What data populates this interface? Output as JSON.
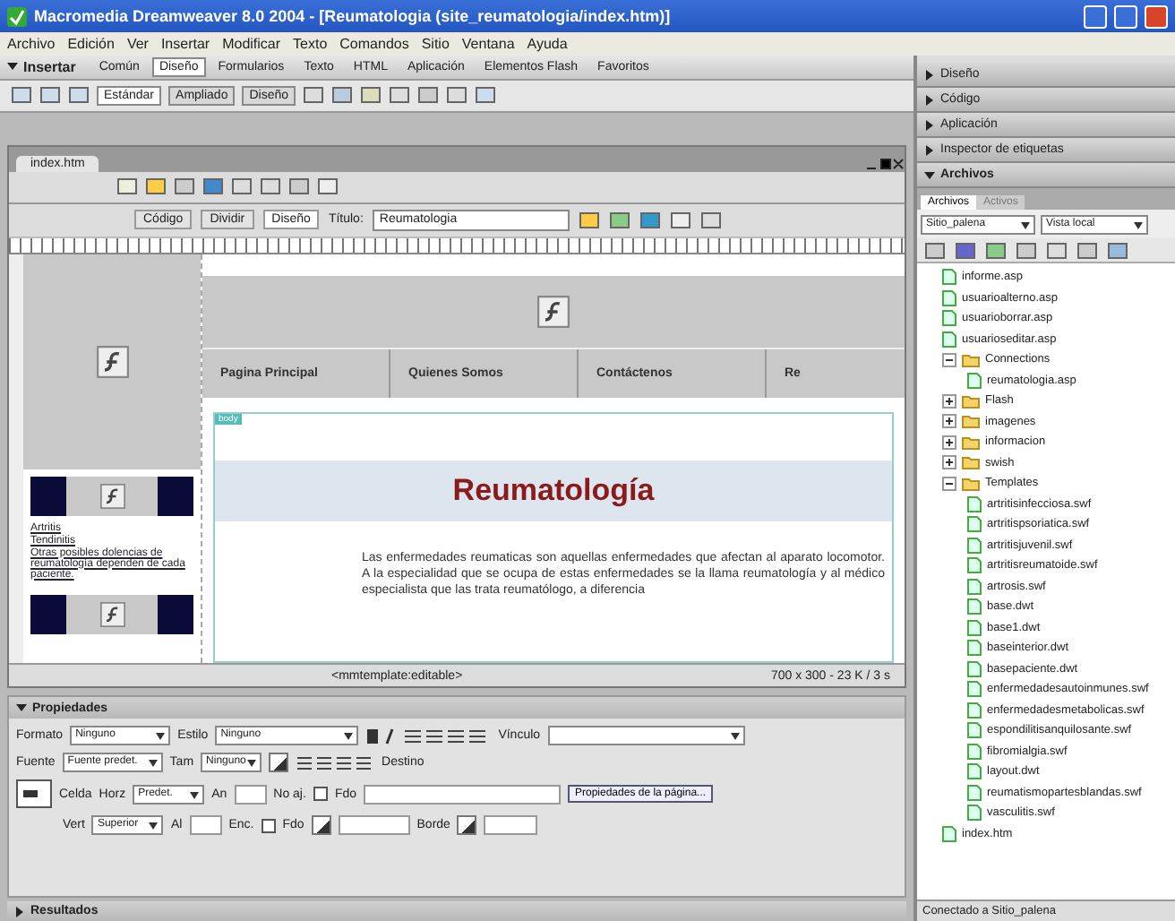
{
  "window": {
    "title": "Macromedia Dreamweaver 8.0 2004 - [Reumatologia (site_reumatologia/index.htm)]"
  },
  "menu": [
    "Archivo",
    "Edición",
    "Ver",
    "Insertar",
    "Modificar",
    "Texto",
    "Comandos",
    "Sitio",
    "Ventana",
    "Ayuda"
  ],
  "insert_bar": {
    "title": "Insertar",
    "tabs": [
      {
        "label": "Común",
        "selected": false
      },
      {
        "label": "Diseño",
        "selected": true
      },
      {
        "label": "Formularios",
        "selected": false
      },
      {
        "label": "Texto",
        "selected": false
      },
      {
        "label": "HTML",
        "selected": false
      },
      {
        "label": "Aplicación",
        "selected": false
      },
      {
        "label": "Elementos Flash",
        "selected": false
      },
      {
        "label": "Favoritos",
        "selected": false
      }
    ],
    "layout_modes": [
      {
        "label": "Estándar",
        "selected": true
      },
      {
        "label": "Ampliado",
        "selected": false
      },
      {
        "label": "Diseño",
        "selected": false
      }
    ]
  },
  "document": {
    "tab": "index.htm",
    "views": [
      {
        "label": "Código",
        "selected": false
      },
      {
        "label": "Dividir",
        "selected": false
      },
      {
        "label": "Diseño",
        "selected": true
      }
    ],
    "title_label": "Título:",
    "title_value": "Reumatologia"
  },
  "page": {
    "nav": [
      "Pagina Principal",
      "Quienes Somos",
      "Contáctenos",
      "Re"
    ],
    "region_label": "body",
    "sidebar_links": [
      "Artritis",
      "Tendinitis",
      "Otras posibles dolencias de reumatología dependen de cada paciente."
    ],
    "heading": "Reumatología",
    "paragraph": "Las enfermedades reumaticas son aquellas enfermedades que afectan al aparato locomotor. A la especialidad que se ocupa de estas enfermedades se la llama reumatología y al médico especialista que las trata reumatólogo, a diferencia"
  },
  "status": {
    "tag": "<mmtemplate:editable>",
    "info": "700 x 300 - 23 K / 3 s"
  },
  "properties": {
    "title": "Propiedades",
    "rows": [
      [
        {
          "kind": "label",
          "text": "Formato"
        },
        {
          "kind": "select",
          "text": "Ninguno"
        },
        {
          "kind": "label",
          "text": "Estilo"
        },
        {
          "kind": "select",
          "text": "Ninguno"
        },
        {
          "kind": "format"
        },
        {
          "kind": "label",
          "text": "Vínculo"
        },
        {
          "kind": "select"
        }
      ],
      [
        {
          "kind": "label",
          "text": "Fuente"
        },
        {
          "kind": "select",
          "text": "Fuente predet."
        },
        {
          "kind": "label",
          "text": "Tam"
        },
        {
          "kind": "select",
          "text": "Ninguno"
        },
        {
          "kind": "swatch"
        },
        {
          "kind": "lists"
        },
        {
          "kind": "label",
          "text": "Destino"
        }
      ],
      [
        {
          "kind": "label",
          "text": "Celda"
        },
        {
          "kind": "label",
          "text": "Horz"
        },
        {
          "kind": "select",
          "text": "Predet."
        },
        {
          "kind": "label",
          "text": "An"
        },
        {
          "kind": "input"
        },
        {
          "kind": "label",
          "text": "No aj."
        },
        {
          "kind": "check",
          "checked": false
        },
        {
          "kind": "label",
          "text": "Fdo"
        },
        {
          "kind": "input"
        },
        {
          "kind": "button",
          "text": "Propiedades de la página..."
        }
      ],
      [
        {
          "kind": "label",
          "text": "Vert"
        },
        {
          "kind": "select",
          "text": "Superior"
        },
        {
          "kind": "label",
          "text": "Al"
        },
        {
          "kind": "input"
        },
        {
          "kind": "label",
          "text": "Enc."
        },
        {
          "kind": "check",
          "checked": false
        },
        {
          "kind": "label",
          "text": "Fdo"
        },
        {
          "kind": "swatch"
        },
        {
          "kind": "input"
        },
        {
          "kind": "label",
          "text": "Borde"
        },
        {
          "kind": "swatch"
        },
        {
          "kind": "input"
        }
      ]
    ]
  },
  "results": {
    "title": "Resultados"
  },
  "panels": [
    {
      "label": "Diseño",
      "expanded": false
    },
    {
      "label": "Código",
      "expanded": false
    },
    {
      "label": "Aplicación",
      "expanded": false
    },
    {
      "label": "Inspector de etiquetas",
      "expanded": false
    },
    {
      "label": "Archivos",
      "expanded": true
    }
  ],
  "files": {
    "tabs": [
      {
        "label": "Archivos",
        "selected": true
      },
      {
        "label": "Activos",
        "selected": false
      }
    ],
    "site": "Sitio_palena",
    "view": "Vista local",
    "tree": [
      {
        "name": "informe.asp",
        "kind": "file"
      },
      {
        "name": "usuarioalterno.asp",
        "kind": "file"
      },
      {
        "name": "usuarioborrar.asp",
        "kind": "file"
      },
      {
        "name": "usuarioseditar.asp",
        "kind": "file"
      },
      {
        "name": "Connections",
        "kind": "folder",
        "expanded": true,
        "children": [
          {
            "name": "reumatologia.asp",
            "kind": "file"
          }
        ]
      },
      {
        "name": "Flash",
        "kind": "folder",
        "expanded": false
      },
      {
        "name": "imagenes",
        "kind": "folder",
        "expanded": false
      },
      {
        "name": "informacion",
        "kind": "folder",
        "expanded": false
      },
      {
        "name": "swish",
        "kind": "folder",
        "expanded": false
      },
      {
        "name": "Templates",
        "kind": "folder",
        "expanded": true,
        "children": [
          {
            "name": "artritisinfecciosa.swf",
            "kind": "file"
          },
          {
            "name": "artritispsoriatica.swf",
            "kind": "file"
          },
          {
            "name": "artritisjuvenil.swf",
            "kind": "file"
          },
          {
            "name": "artritisreumatoide.swf",
            "kind": "file"
          },
          {
            "name": "artrosis.swf",
            "kind": "file"
          },
          {
            "name": "base.dwt",
            "kind": "file"
          },
          {
            "name": "base1.dwt",
            "kind": "file"
          },
          {
            "name": "baseinterior.dwt",
            "kind": "file"
          },
          {
            "name": "basepaciente.dwt",
            "kind": "file"
          },
          {
            "name": "enfermedadesautoinmunes.swf",
            "kind": "file"
          },
          {
            "name": "enfermedadesmetabolicas.swf",
            "kind": "file"
          },
          {
            "name": "espondilitisanquilosante.swf",
            "kind": "file"
          },
          {
            "name": "fibromialgia.swf",
            "kind": "file"
          },
          {
            "name": "layout.dwt",
            "kind": "file"
          },
          {
            "name": "reumatismopartesblandas.swf",
            "kind": "file"
          },
          {
            "name": "vasculitis.swf",
            "kind": "file"
          }
        ]
      },
      {
        "name": "index.htm",
        "kind": "file"
      }
    ],
    "status": "Conectado a Sitio_palena"
  }
}
